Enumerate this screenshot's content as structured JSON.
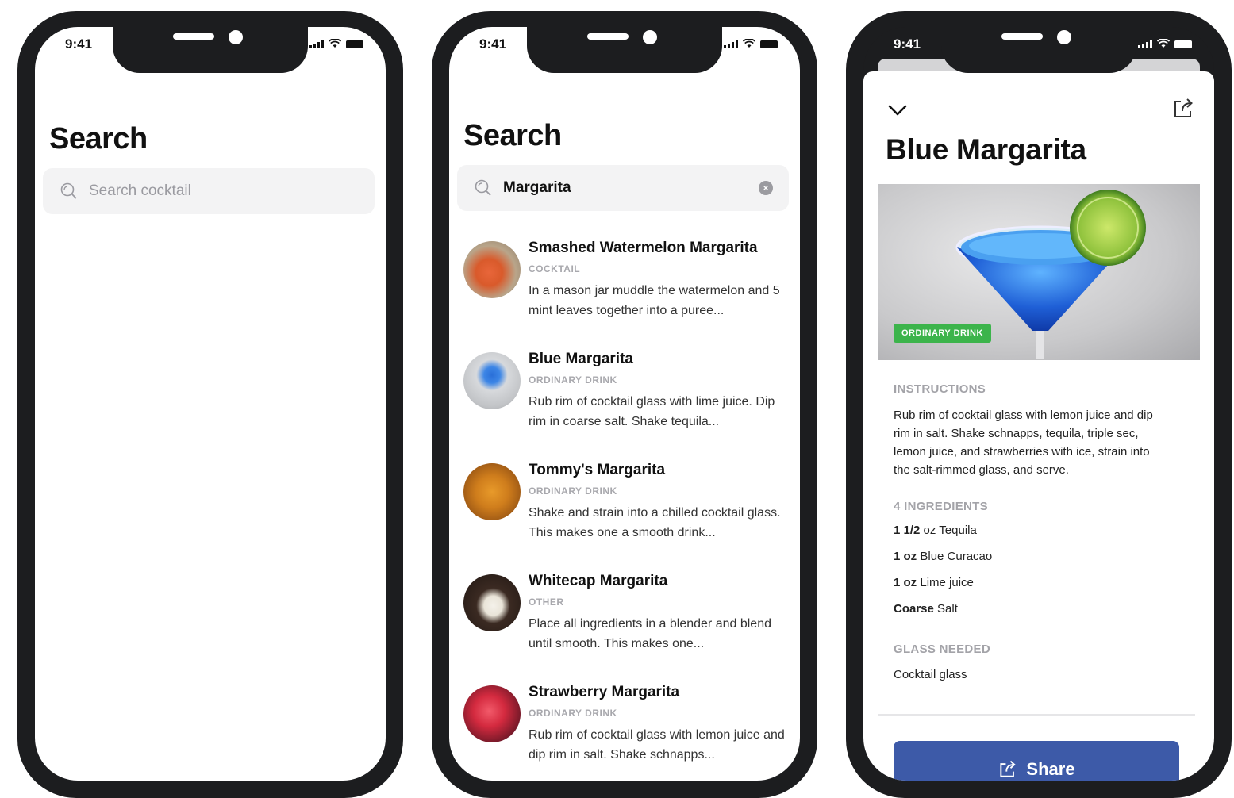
{
  "status_bar": {
    "time": "9:41"
  },
  "screen1": {
    "title": "Search",
    "search_placeholder": "Search cocktail"
  },
  "screen2": {
    "title": "Search",
    "search_value": "Margarita",
    "results": [
      {
        "title": "Smashed Watermelon Margarita",
        "category": "COCKTAIL",
        "desc": "In a mason jar muddle the watermelon and 5 mint leaves together into a puree..."
      },
      {
        "title": "Blue Margarita",
        "category": "ORDINARY DRINK",
        "desc": "Rub rim of cocktail glass with lime juice. Dip rim in coarse salt. Shake tequila..."
      },
      {
        "title": "Tommy's Margarita",
        "category": "ORDINARY DRINK",
        "desc": "Shake and strain into a chilled cocktail glass. This makes one a smooth drink..."
      },
      {
        "title": "Whitecap Margarita",
        "category": "OTHER",
        "desc": "Place all ingredients in a blender and blend until smooth. This makes one..."
      },
      {
        "title": "Strawberry Margarita",
        "category": "ORDINARY DRINK",
        "desc": "Rub rim of cocktail glass with lemon juice and dip rim in salt. Shake schnapps..."
      }
    ]
  },
  "screen3": {
    "title": "Blue Margarita",
    "badge": "ORDINARY DRINK",
    "instructions_label": "INSTRUCTIONS",
    "instructions": "Rub rim of cocktail glass with lemon juice and dip rim in salt. Shake schnapps, tequila, triple sec, lemon juice, and strawberries with ice, strain into the salt-rimmed glass, and serve.",
    "ingredients_label": "4 INGREDIENTS",
    "ingredients": [
      {
        "measure": "1 1/2",
        "unit": "oz",
        "name": "Tequila"
      },
      {
        "measure": "1",
        "unit": "oz",
        "name": "Blue Curacao"
      },
      {
        "measure": "1",
        "unit": "oz",
        "name": "Lime juice"
      },
      {
        "measure": "Coarse",
        "unit": "",
        "name": "Salt"
      }
    ],
    "glass_label": "GLASS NEEDED",
    "glass": "Cocktail glass",
    "share_label": "Share"
  },
  "colors": {
    "phone_frame": "#1c1d1f",
    "badge_green": "#3cb44b",
    "share_button": "#3d5aa8",
    "muted_label": "#a3a3a8"
  },
  "icons": [
    "search-icon",
    "clear-icon",
    "chevron-down-icon",
    "share-icon",
    "signal-icon",
    "wifi-icon",
    "battery-icon"
  ]
}
